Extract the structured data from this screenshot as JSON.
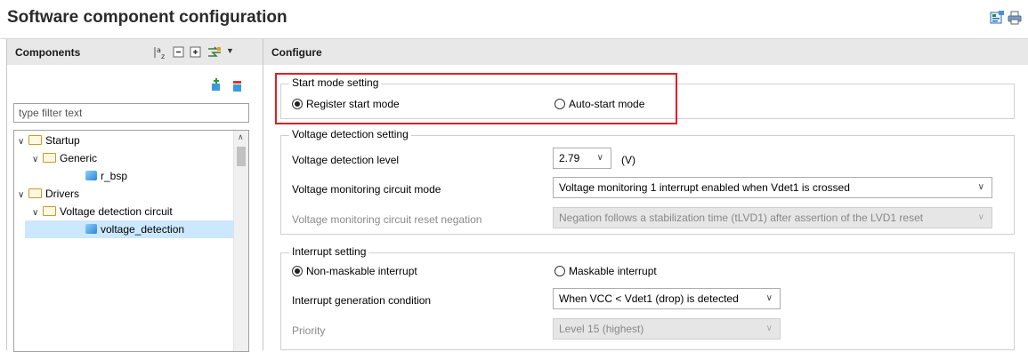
{
  "window": {
    "title": "Software component configuration",
    "icons": [
      "generate-code-icon",
      "print-icon"
    ]
  },
  "components_panel": {
    "header": "Components",
    "toolbar_icons": [
      "sort-az-icon",
      "collapse-all-icon",
      "expand-all-icon",
      "view-menu-icon",
      "chevron-down-icon"
    ],
    "action_icons": [
      "add-component-icon",
      "remove-component-icon"
    ],
    "filter_placeholder": "type filter text",
    "tree": [
      {
        "label": "Startup",
        "level": 0,
        "expanded": true,
        "type": "folder"
      },
      {
        "label": "Generic",
        "level": 1,
        "expanded": true,
        "type": "folder"
      },
      {
        "label": "r_bsp",
        "level": 2,
        "type": "component"
      },
      {
        "label": "Drivers",
        "level": 0,
        "expanded": true,
        "type": "folder"
      },
      {
        "label": "Voltage detection circuit",
        "level": 1,
        "expanded": true,
        "type": "folder"
      },
      {
        "label": "voltage_detection",
        "level": 2,
        "type": "component",
        "selected": true
      }
    ]
  },
  "configure_panel": {
    "header": "Configure",
    "start_mode": {
      "title": "Start mode setting",
      "options": [
        "Register start mode",
        "Auto-start mode"
      ],
      "selected": "Register start mode"
    },
    "voltage_detection": {
      "title": "Voltage detection setting",
      "level_label": "Voltage detection level",
      "level_value": "2.79",
      "level_unit": "(V)",
      "monitor_mode_label": "Voltage monitoring circuit mode",
      "monitor_mode_value": "Voltage monitoring 1 interrupt enabled when Vdet1 is crossed",
      "reset_negation_label": "Voltage monitoring circuit reset negation",
      "reset_negation_value": "Negation follows a stabilization time (tLVD1) after assertion of the LVD1 reset"
    },
    "interrupt": {
      "title": "Interrupt setting",
      "options": [
        "Non-maskable interrupt",
        "Maskable interrupt"
      ],
      "selected": "Non-maskable interrupt",
      "condition_label": "Interrupt generation condition",
      "condition_value": "When VCC < Vdet1 (drop) is detected",
      "priority_label": "Priority",
      "priority_value": "Level 15 (highest)"
    }
  },
  "colors": {
    "highlight_box": "#e21e26",
    "selection": "#cce8ff",
    "panel_header": "#e8e8e8"
  }
}
